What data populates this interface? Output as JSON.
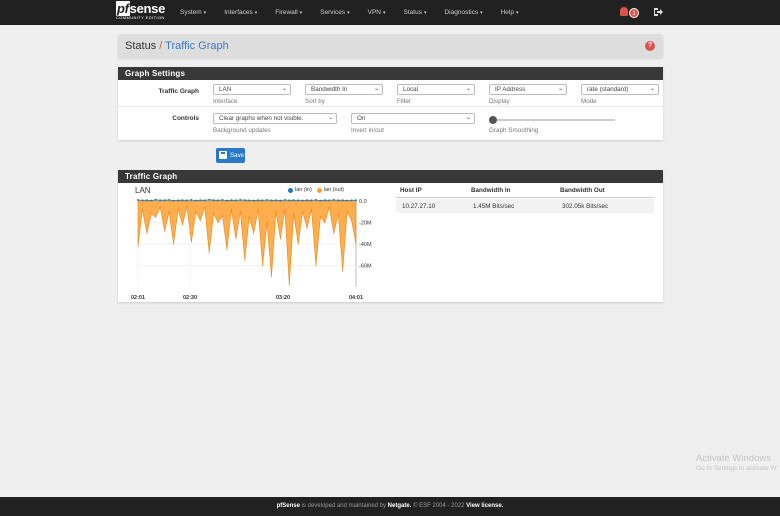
{
  "navbar": {
    "logo_brand_pf": "pf",
    "logo_brand_rest": "sense",
    "logo_edition": "COMMUNITY EDITION",
    "menu": [
      {
        "label": "System"
      },
      {
        "label": "Interfaces"
      },
      {
        "label": "Firewall"
      },
      {
        "label": "Services"
      },
      {
        "label": "VPN"
      },
      {
        "label": "Status"
      },
      {
        "label": "Diagnostics"
      },
      {
        "label": "Help"
      }
    ],
    "notification_count": "1",
    "accent_color": "#d9534f"
  },
  "breadcrumb": {
    "parent": "Status",
    "separator": "/",
    "current": "Traffic Graph"
  },
  "settings": {
    "heading": "Graph Settings",
    "traffic_graph_label": "Traffic Graph",
    "controls_label": "Controls",
    "interface": {
      "value": "LAN",
      "help": "Interface"
    },
    "sort_by": {
      "value": "Bandwidth In",
      "help": "Sort by"
    },
    "filter": {
      "value": "Local",
      "help": "Filter"
    },
    "display": {
      "value": "IP Address",
      "help": "Display"
    },
    "mode": {
      "value": "rate (standard)",
      "help": "Mode"
    },
    "background_updates": {
      "value": "Clear graphs when not visible.",
      "help": "Background updates"
    },
    "invert": {
      "value": "On",
      "help": "Invert in/out"
    },
    "smoothing": {
      "help": "Graph Smoothing",
      "value": 0
    },
    "save_label": "Save"
  },
  "graph_panel": {
    "heading": "Traffic Graph",
    "interface_title": "LAN",
    "table": {
      "headers": [
        "Host IP",
        "Bandwidth In",
        "Bandwidth Out"
      ],
      "rows": [
        [
          "10.27.27.10",
          "1.45M Bits/sec",
          "302.05k Bits/sec"
        ]
      ]
    }
  },
  "chart_data": {
    "type": "area",
    "title": "LAN",
    "series": [
      {
        "name": "lan (in)",
        "color": "#1f77b4",
        "values": [
          0.5,
          0.3,
          0.4,
          0.2,
          0.6,
          0.3,
          0.4,
          0.5,
          0.2,
          0.3,
          0.4,
          0.3,
          0.5,
          0.2,
          0.4,
          0.3,
          0.6,
          0.4,
          0.3,
          0.5,
          0.2,
          0.4,
          0.3,
          0.5,
          0.4,
          0.3,
          0.2,
          0.4,
          0.3,
          0.5,
          0.3,
          0.4,
          0.2,
          0.5,
          0.3,
          0.4,
          0.3,
          0.2,
          0.4,
          0.3,
          0.5,
          0.2,
          0.4,
          0.3,
          0.5,
          0.3,
          0.4,
          0.2,
          0.3,
          0.4
        ]
      },
      {
        "name": "lan (out)",
        "color": "#ff9f2e",
        "values": [
          -42,
          -8,
          -30,
          -12,
          -15,
          -6,
          -28,
          -10,
          -40,
          -8,
          -22,
          -5,
          -38,
          -10,
          -18,
          -6,
          -48,
          -12,
          -20,
          -14,
          -45,
          -8,
          -35,
          -10,
          -55,
          -15,
          -30,
          -8,
          -60,
          -20,
          -70,
          -10,
          -35,
          -8,
          -78,
          -12,
          -40,
          -10,
          -25,
          -8,
          -60,
          -15,
          -20,
          -6,
          -30,
          -12,
          -65,
          -10,
          -18,
          -40
        ]
      }
    ],
    "x_ticks": [
      "02:01",
      "02:30",
      "03:20",
      "04:01"
    ],
    "y_ticks": [
      "0.0",
      "-20M",
      "-40M",
      "-60M"
    ],
    "ylim": [
      -80,
      0
    ],
    "legend_position": "top-right",
    "grid": true
  },
  "footer": {
    "brand": "pfSense",
    "text1": " is developed and maintained by ",
    "company": "Netgate.",
    "text2": " © ESF 2004 - 2022 ",
    "license": "View license."
  },
  "watermark": {
    "line1": "Activate Windows",
    "line2": "Go to Settings to activate W"
  }
}
